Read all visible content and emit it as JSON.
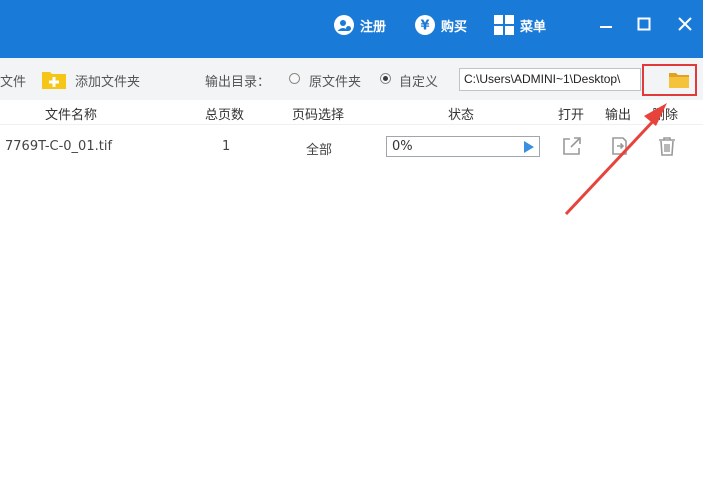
{
  "titlebar": {
    "register_label": "注册",
    "buy_label": "购买",
    "menu_label": "菜单"
  },
  "toolbar": {
    "add_file_partial": "文件",
    "add_folder_label": "添加文件夹",
    "output_dir_label": "输出目录：",
    "option_original": "原文件夹",
    "option_custom": "自定义",
    "selected_option": "自定义",
    "path_value": "C:\\Users\\ADMINI~1\\Desktop\\"
  },
  "table": {
    "headers": [
      "文件名称",
      "总页数",
      "页码选择",
      "状态",
      "打开",
      "输出",
      "删除"
    ],
    "rows": [
      {
        "filename": "7769T-C-0_01.tif",
        "pages": "1",
        "page_select": "全部",
        "status": "0%"
      }
    ]
  },
  "colors": {
    "titlebar": "#1a7ad8",
    "highlight_box": "#e03a3a",
    "folder": "#f1b52c",
    "play": "#3a8fe0"
  },
  "icons": [
    "user-icon",
    "yen-icon",
    "grid-menu-icon",
    "minimize-icon",
    "maximize-icon",
    "close-icon",
    "add-folder-icon",
    "folder-icon",
    "play-icon",
    "open-external-icon",
    "export-icon",
    "trash-icon"
  ]
}
